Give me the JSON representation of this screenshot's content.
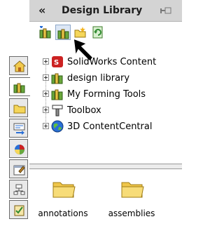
{
  "header": {
    "collapse_symbol": "«",
    "title": "Design Library",
    "pin_icon": "pin-icon"
  },
  "toolbar": {
    "buttons": [
      {
        "name": "add-to-library-button",
        "icon": "add-to-library-icon"
      },
      {
        "name": "add-file-location-button",
        "icon": "add-file-location-icon",
        "pressed": true
      },
      {
        "name": "create-new-folder-button",
        "icon": "new-folder-icon"
      },
      {
        "name": "refresh-button",
        "icon": "refresh-icon"
      }
    ]
  },
  "tree": {
    "items": [
      {
        "label": "SolidWorks Content",
        "icon": "solidworks-content-icon"
      },
      {
        "label": "design library",
        "icon": "design-library-icon"
      },
      {
        "label": "My Forming Tools",
        "icon": "design-library-icon"
      },
      {
        "label": "Toolbox",
        "icon": "toolbox-icon"
      },
      {
        "label": "3D ContentCentral",
        "icon": "globe-icon"
      }
    ]
  },
  "folders": [
    {
      "label": "annotations"
    },
    {
      "label": "assemblies"
    }
  ],
  "side_tabs": [
    {
      "name": "tab-home",
      "icon": "home-icon"
    },
    {
      "name": "tab-design-library",
      "icon": "design-library-icon",
      "active": true
    },
    {
      "name": "tab-file-explorer",
      "icon": "folder-icon"
    },
    {
      "name": "tab-view-palette",
      "icon": "view-palette-icon"
    },
    {
      "name": "tab-appearances",
      "icon": "appearances-icon"
    },
    {
      "name": "tab-custom-properties",
      "icon": "custom-properties-icon"
    },
    {
      "name": "tab-tasks",
      "icon": "tasks-icon"
    },
    {
      "name": "tab-design-checker",
      "icon": "design-checker-icon"
    }
  ],
  "colors": {
    "header_bg": "#d4d4d4",
    "folder_yellow": "#f5d65a",
    "library_green": "#6aa83c",
    "solidworks_red": "#cc2222",
    "globe_blue": "#2a6fd6"
  }
}
